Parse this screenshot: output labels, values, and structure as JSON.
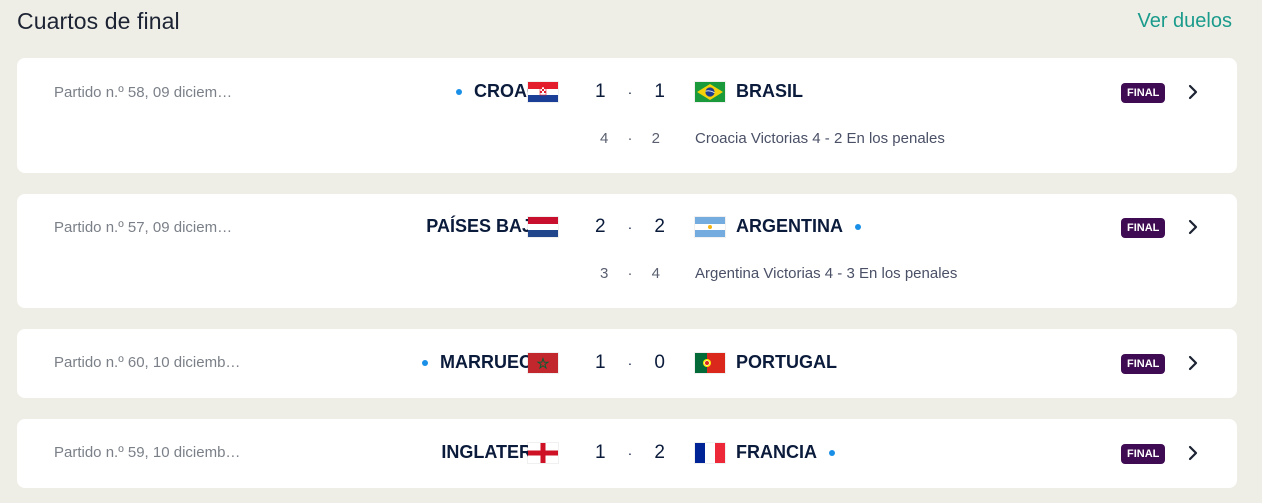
{
  "header": {
    "title": "Cuartos de final",
    "link": "Ver duelos"
  },
  "colors": {
    "accent": "#1a9b8c",
    "badge": "#3f0b52",
    "dot": "#1a8fe8"
  },
  "matches": [
    {
      "meta": "Partido n.º 58, 09 diciem…",
      "home": "CROACIA",
      "home_dot": true,
      "home_flag": "croatia-flag-icon",
      "home_score": "1",
      "separator": "·",
      "away_score": "1",
      "away": "BRASIL",
      "away_dot": false,
      "away_flag": "brazil-flag-icon",
      "pen_home": "4",
      "pen_away": "2",
      "pen_text": "Croacia Victorias 4 - 2  En los penales",
      "status": "FINAL"
    },
    {
      "meta": "Partido n.º 57, 09 diciem…",
      "home": "PAÍSES BAJOS",
      "home_dot": false,
      "home_flag": "netherlands-flag-icon",
      "home_score": "2",
      "separator": "·",
      "away_score": "2",
      "away": "ARGENTINA",
      "away_dot": true,
      "away_flag": "argentina-flag-icon",
      "pen_home": "3",
      "pen_away": "4",
      "pen_text": "Argentina Victorias 4 - 3  En los penales",
      "status": "FINAL"
    },
    {
      "meta": "Partido n.º 60, 10 diciemb…",
      "home": "MARRUECOS",
      "home_dot": true,
      "home_flag": "morocco-flag-icon",
      "home_score": "1",
      "separator": "·",
      "away_score": "0",
      "away": "PORTUGAL",
      "away_dot": false,
      "away_flag": "portugal-flag-icon",
      "status": "FINAL"
    },
    {
      "meta": "Partido n.º 59, 10 diciemb…",
      "home": "INGLATERRA",
      "home_dot": false,
      "home_flag": "england-flag-icon",
      "home_score": "1",
      "separator": "·",
      "away_score": "2",
      "away": "FRANCIA",
      "away_dot": true,
      "away_flag": "france-flag-icon",
      "status": "FINAL"
    }
  ]
}
